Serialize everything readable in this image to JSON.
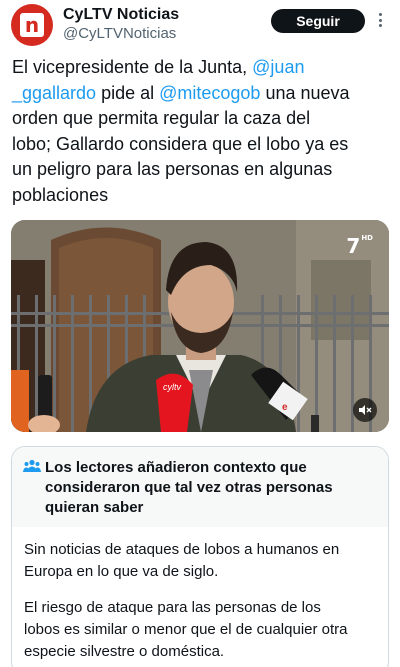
{
  "account": {
    "name": "CyLTV Noticias",
    "handle": "@CyLTVNoticias",
    "avatar_letter": "n",
    "avatar_color": "#d42a20"
  },
  "follow_label": "Seguir",
  "tweet": {
    "lines": [
      {
        "before": "El vicepresidente de la Junta, ",
        "mention": "@juan",
        "after": ""
      },
      {
        "before": "",
        "mention": "_ggallardo",
        "after": " pide al ",
        "mention2": "@mitecogob",
        "after2": " una nueva"
      },
      {
        "before": "orden que permita regular la caza del",
        "mention": "",
        "after": ""
      },
      {
        "before": "lobo; Gallardo considera que el lobo ya es",
        "mention": "",
        "after": ""
      },
      {
        "before": "un peligro para las personas en algunas",
        "mention": "",
        "after": ""
      },
      {
        "before": "poblaciones",
        "mention": "",
        "after": ""
      }
    ]
  },
  "media": {
    "channel_logo": "7",
    "channel_logo_sub": "HD",
    "mic_logo_1": "cyltv",
    "mic_logo_2": "e"
  },
  "community_note": {
    "title_lines": [
      "Los lectores añadieron contexto que",
      "consideraron que tal vez otras personas",
      "quieran saber"
    ],
    "paragraph_1_lines": [
      "Sin noticias de ataques de lobos a humanos en",
      "Europa en lo que va de siglo."
    ],
    "paragraph_2_lines": [
      "El riesgo de ataque para las personas de los",
      "lobos es similar o menor que el de cualquier otra",
      "especie silvestre o doméstica."
    ]
  },
  "colors": {
    "link": "#1d9bf0",
    "text": "#0f1419",
    "secondary": "#536471",
    "button_bg": "#0f1419"
  },
  "icons": {
    "more": "more-dots-icon",
    "mute": "volume-muted-icon",
    "note": "people-group-icon"
  }
}
